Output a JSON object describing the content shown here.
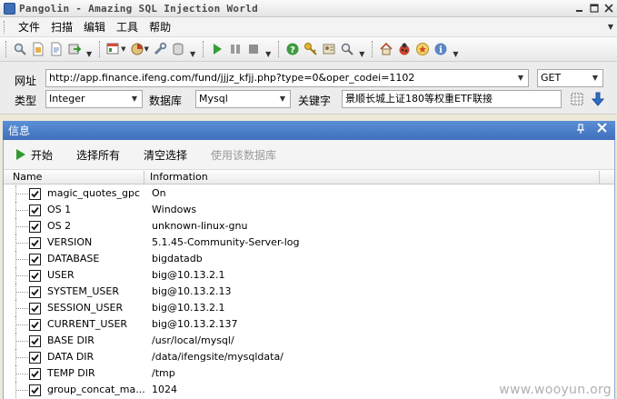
{
  "window": {
    "title": "Pangolin - Amazing SQL Injection World"
  },
  "menu": {
    "items": [
      "文件",
      "扫描",
      "编辑",
      "工具",
      "帮助"
    ]
  },
  "toolbar": {
    "icons": [
      "magnifier-icon",
      "new-file-icon",
      "open-file-icon",
      "export-icon",
      "app-window-icon",
      "pie-tools-icon",
      "wrench-icon",
      "database-icon",
      "play-icon",
      "pause-icon",
      "stop-icon",
      "help-icon",
      "key-icon",
      "user-icon",
      "search-icon",
      "home-icon",
      "ladybug-icon",
      "favorites-icon",
      "info-icon"
    ]
  },
  "form": {
    "url_label": "网址",
    "url_value": "http://app.finance.ifeng.com/fund/jjjz_kfjj.php?type=0&oper_codei=1102",
    "method_value": "GET",
    "type_label": "类型",
    "type_value": "Integer",
    "db_label": "数据库",
    "db_value": "Mysql",
    "keyword_label": "关键字",
    "keyword_value": "景顺长城上证180等权重ETF联接"
  },
  "panel": {
    "title": "信息",
    "actions": {
      "start": "开始",
      "select_all": "选择所有",
      "clear_selection": "清空选择",
      "use_database": "使用该数据库"
    },
    "columns": {
      "name": "Name",
      "info": "Information"
    },
    "rows": [
      {
        "name": "magic_quotes_gpc",
        "info": "On",
        "checked": true
      },
      {
        "name": "OS 1",
        "info": "Windows",
        "checked": true
      },
      {
        "name": "OS 2",
        "info": "unknown-linux-gnu",
        "checked": true
      },
      {
        "name": "VERSION",
        "info": "5.1.45-Community-Server-log",
        "checked": true
      },
      {
        "name": "DATABASE",
        "info": "bigdatadb",
        "checked": true
      },
      {
        "name": "USER",
        "info": "big@10.13.2.1",
        "checked": true
      },
      {
        "name": "SYSTEM_USER",
        "info": "big@10.13.2.13",
        "checked": true
      },
      {
        "name": "SESSION_USER",
        "info": "big@10.13.2.1",
        "checked": true
      },
      {
        "name": "CURRENT_USER",
        "info": "big@10.13.2.137",
        "checked": true
      },
      {
        "name": "BASE DIR",
        "info": "/usr/local/mysql/",
        "checked": true
      },
      {
        "name": "DATA DIR",
        "info": "/data/ifengsite/mysqldata/",
        "checked": true
      },
      {
        "name": "TEMP DIR",
        "info": "/tmp",
        "checked": true
      },
      {
        "name": "group_concat_ma...",
        "info": "1024",
        "checked": true
      }
    ]
  },
  "watermark": "www.wooyun.org"
}
